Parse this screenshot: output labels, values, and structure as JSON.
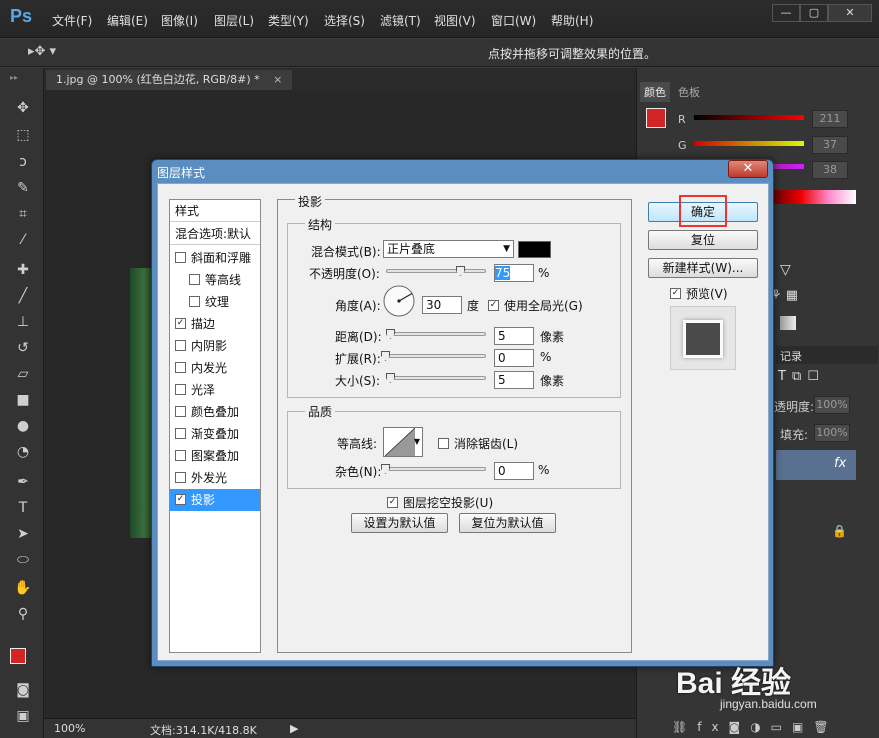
{
  "app": {
    "logo": "Ps"
  },
  "menu": [
    "文件(F)",
    "编辑(E)",
    "图像(I)",
    "图层(L)",
    "类型(Y)",
    "选择(S)",
    "滤镜(T)",
    "视图(V)",
    "窗口(W)",
    "帮助(H)"
  ],
  "window_buttons": [
    "—",
    "▢",
    "✕"
  ],
  "options_bar": {
    "hint": "点按并拖移可调整效果的位置。"
  },
  "document": {
    "tab": "1.jpg @ 100% (红色白边花, RGB/8#) *",
    "tab_close": "×"
  },
  "status": {
    "zoom": "100%",
    "doc_info": "文档:314.1K/418.8K"
  },
  "right_panel": {
    "tabs": [
      "颜色",
      "色板"
    ],
    "r_label": "R",
    "r_value": "211",
    "g_label": "G",
    "g_value": "37",
    "b_value": "38",
    "history_tab": "记录",
    "opacity_label": "透明度:",
    "opacity_value": "100%",
    "fill_label": "填充:",
    "fill_value": "100%",
    "fx_label": "fx"
  },
  "dialog": {
    "title": "图层样式",
    "close": "✕",
    "styles_header": "样式",
    "blend_options": "混合选项:默认",
    "style_items": [
      {
        "label": "斜面和浮雕",
        "checked": false
      },
      {
        "label": "等高线",
        "checked": false
      },
      {
        "label": "纹理",
        "checked": false
      },
      {
        "label": "描边",
        "checked": true
      },
      {
        "label": "内阴影",
        "checked": false
      },
      {
        "label": "内发光",
        "checked": false
      },
      {
        "label": "光泽",
        "checked": false
      },
      {
        "label": "颜色叠加",
        "checked": false
      },
      {
        "label": "渐变叠加",
        "checked": false
      },
      {
        "label": "图案叠加",
        "checked": false
      },
      {
        "label": "外发光",
        "checked": false
      },
      {
        "label": "投影",
        "checked": true
      }
    ],
    "panel_title": "投影",
    "structure": {
      "legend": "结构",
      "blend_mode_label": "混合模式(B):",
      "blend_mode_value": "正片叠底",
      "opacity_label": "不透明度(O):",
      "opacity_value": "75",
      "opacity_unit": "%",
      "opacity_level": 0.75,
      "angle_label": "角度(A):",
      "angle_value": "30",
      "angle_unit": "度",
      "global_light_label": "使用全局光(G)",
      "global_light_checked": true,
      "distance_label": "距离(D):",
      "distance_value": "5",
      "distance_unit": "像素",
      "spread_label": "扩展(R):",
      "spread_value": "0",
      "spread_unit": "%",
      "size_label": "大小(S):",
      "size_value": "5",
      "size_unit": "像素"
    },
    "quality": {
      "legend": "品质",
      "contour_label": "等高线:",
      "antialias_label": "消除锯齿(L)",
      "antialias_checked": false,
      "noise_label": "杂色(N):",
      "noise_value": "0",
      "noise_unit": "%"
    },
    "knockout_label": "图层挖空投影(U)",
    "knockout_checked": true,
    "make_default": "设置为默认值",
    "reset_default": "复位为默认值",
    "ok": "确定",
    "reset": "复位",
    "new_style": "新建样式(W)...",
    "preview_label": "预览(V)",
    "preview_checked": true
  },
  "watermark": {
    "logo": "Bai 经验",
    "url": "jingyan.baidu.com"
  },
  "colors": {
    "foreground": "#d32526",
    "background": "#ffffff",
    "selection": "#3399ff",
    "highlight_box": "#e33333"
  }
}
